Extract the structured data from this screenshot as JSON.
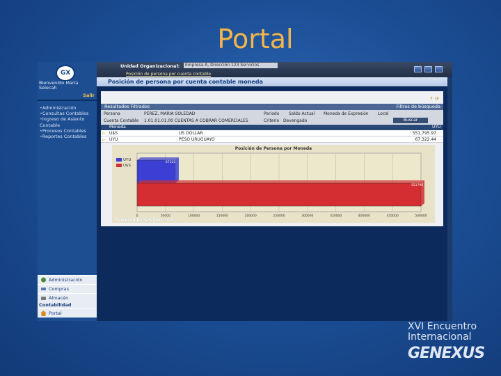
{
  "slide": {
    "title": "Portal"
  },
  "sidebar": {
    "logo_text": "GX",
    "welcome": "Bienvenido María Selecah",
    "logout": "Salir",
    "menu": [
      "Administración",
      "Consultas Contables",
      "Ingreso de Asiento Contable",
      "Procesos Contables",
      "Reportes Contables"
    ],
    "bottom_nav": [
      "Administración",
      "Compras",
      "Almacén"
    ],
    "bottom_label": "Contabilidad",
    "portal": "Portal"
  },
  "topbar": {
    "unit_label": "Unidad Organizacional:",
    "unit_value": "Empresa A, Dirección 123 Servicios",
    "breadcrumb": "Posición de persona por cuenta contable"
  },
  "page": {
    "heading": "Posición de persona por cuenta contable moneda"
  },
  "results": {
    "bar_title": "Resultados Filtrados",
    "filters_title": "Filtros de búsqueda",
    "persona_label": "Persona",
    "persona_value": "PEREZ, MARIA SOLEDAD",
    "periodo_label": "Periodo",
    "periodo_value": "Saldo Actual",
    "moneda_label": "Moneda de Expresión",
    "moneda_value": "Local",
    "cuenta_label": "Cuenta Contable",
    "cuenta_value": "1.01.01.01.00 CUENTAS A COBRAR COMERCIALES",
    "criterio_label": "Criterio",
    "criterio_value": "Devengado",
    "search_button": "Buscar"
  },
  "table": {
    "headers": [
      "Moneda",
      "",
      "UYU"
    ],
    "rows": [
      {
        "code": "U$S",
        "name": "US DOLLAR",
        "amount": "551,795.97"
      },
      {
        "code": "UYU",
        "name": "PESO URUGUAYO",
        "amount": "67,322.44"
      }
    ]
  },
  "chart": {
    "legend_uyu_color": "#3b3fd4",
    "legend_usd_color": "#d42e33",
    "powered": "Powered By CxChart.com"
  },
  "chart_data": {
    "type": "bar",
    "orientation": "horizontal",
    "title": "Posición de Persona por Moneda",
    "categories": [
      "UYU",
      "U$S"
    ],
    "values": [
      67322.44,
      551795.97
    ],
    "data_labels": [
      "67322",
      "551796"
    ],
    "xlim": [
      0,
      500000
    ],
    "xticks": [
      "0",
      "50000",
      "100000",
      "150000",
      "200000",
      "250000",
      "300000",
      "350000",
      "400000",
      "450000",
      "500000"
    ],
    "legend": [
      "UYU",
      "U$S"
    ],
    "grid": true
  },
  "branding": {
    "line1": "XVI Encuentro",
    "line2": "Internacional",
    "line3": "GENEXUS"
  }
}
